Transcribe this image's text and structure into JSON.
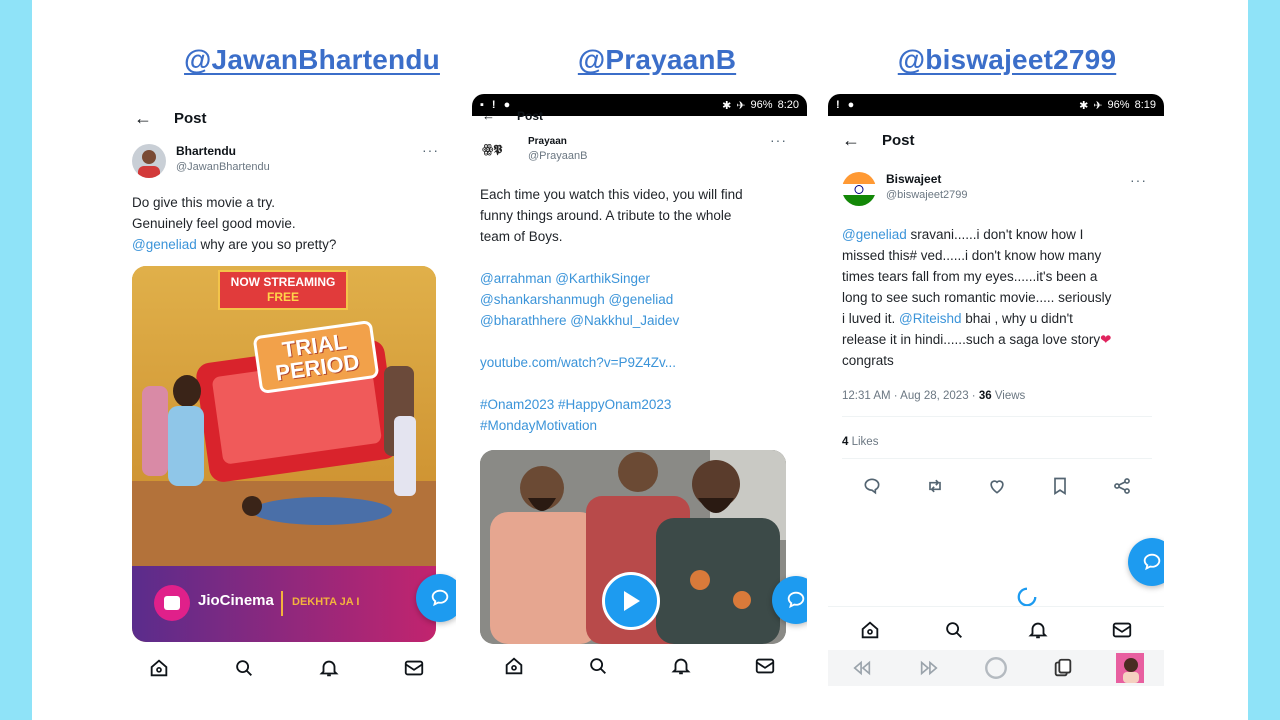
{
  "colors": {
    "page_bg": "#8fe3f8",
    "handle": "#3b6ec9",
    "link": "#3b94d9",
    "fab": "#1d9bf0"
  },
  "panels": [
    {
      "handle": "@JawanBhartendu",
      "header_title": "Post",
      "author_name": "Bhartendu",
      "author_username": "@JawanBhartendu",
      "text_line1": "Do give this movie a try.",
      "text_line2": "Genuinely feel good movie.",
      "mention": "@geneliad",
      "text_line3_rest": " why are you so pretty?",
      "poster": {
        "banner_line1": "NOW STREAMING",
        "banner_line2": "FREE",
        "title_line1": "TRIAL",
        "title_line2": "PERIOD",
        "brand": "JioCinema",
        "tagline": "DEKHTA JA I"
      },
      "nav_icons": [
        "home-icon",
        "search-icon",
        "bell-icon",
        "mail-icon"
      ]
    },
    {
      "handle": "@PrayaanB",
      "status_time": "8:20",
      "status_battery": "96%",
      "header_title": "Post",
      "author_name": "Prayaan",
      "author_username": "@PrayaanB",
      "text_line1": "Each time you  watch this video, you will find",
      "text_line2": "funny things around.  A tribute to the whole",
      "text_line3": "team of Boys.",
      "mention_line1": "@arrahman @KarthikSinger",
      "mention_line2": "@shankarshanmugh @geneliad",
      "mention_line3": "@bharathhere @Nakkhul_Jaidev",
      "url": "youtube.com/watch?v=P9Z4Zv...",
      "hashtags_line1": "#Onam2023 #HappyOnam2023",
      "hashtags_line2": "#MondayMotivation",
      "nav_icons": [
        "home-icon",
        "search-icon",
        "bell-icon",
        "mail-icon"
      ]
    },
    {
      "handle": "@biswajeet2799",
      "status_time": "8:19",
      "status_battery": "96%",
      "header_title": "Post",
      "author_name": "Biswajeet",
      "author_username": "@biswajeet2799",
      "mention1": "@geneliad",
      "text1": " sravani......i don't know how I",
      "text2": "missed this# ved......i don't know how many",
      "text3": "times tears fall from my eyes......it's been a",
      "text4": "long to see such romantic movie..... seriously",
      "text5_a": "i luved it. ",
      "mention2": "@Riteishd",
      "text5_b": " bhai , why u didn't",
      "text6": "release it in hindi......such a saga love story",
      "text7": "congrats",
      "timestamp": "12:31 AM · Aug 28, 2023 · ",
      "views_count": "36",
      "views_label": " Views",
      "likes_count": "4",
      "likes_label": " Likes",
      "nav_icons": [
        "home-icon",
        "search-icon",
        "bell-icon",
        "mail-icon"
      ]
    }
  ]
}
